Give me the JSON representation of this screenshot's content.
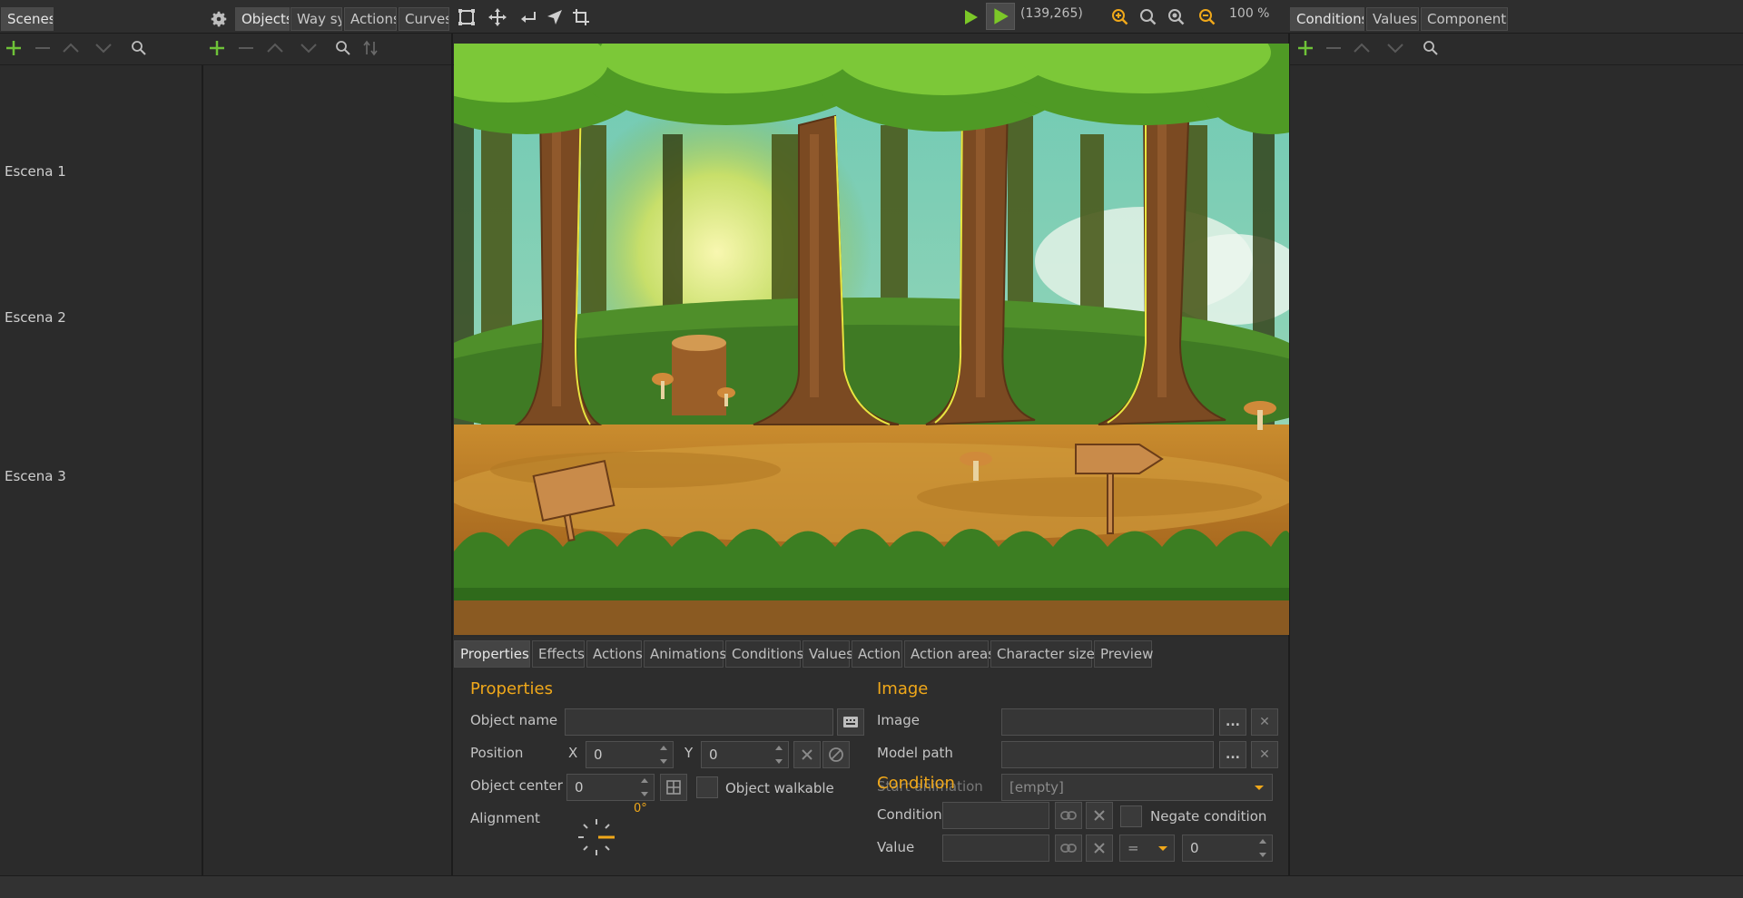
{
  "top_tabs": {
    "scenes": "Scenes",
    "objects": "Objects",
    "way_sys": "Way sys",
    "actions": "Actions",
    "curves": "Curves",
    "conditions": "Conditions",
    "values": "Values",
    "components": "Components"
  },
  "toolbar": {
    "coords": "(139,265)",
    "zoom": "100 %"
  },
  "scenes": [
    "Escena 1",
    "Escena 2",
    "Escena 3"
  ],
  "bottom_tabs": [
    "Properties",
    "Effects",
    "Actions",
    "Animations",
    "Conditions",
    "Values",
    "Action",
    "Action areas",
    "Character size",
    "Preview"
  ],
  "properties": {
    "title": "Properties",
    "object_name_label": "Object name",
    "object_name_value": "",
    "position_label": "Position",
    "x_label": "X",
    "x_value": "0",
    "y_label": "Y",
    "y_value": "0",
    "object_center_label": "Object center",
    "object_center_value": "0",
    "object_walkable_label": "Object walkable",
    "alignment_label": "Alignment",
    "alignment_angle": "0°"
  },
  "image": {
    "title": "Image",
    "image_label": "Image",
    "image_value": "",
    "model_path_label": "Model path",
    "model_path_value": "",
    "animation_label": "Start animation",
    "animation_value": "[empty]",
    "browse_label": "...",
    "clear_label": "✕"
  },
  "condition": {
    "title": "Condition",
    "condition_label": "Condition",
    "condition_value": "",
    "negate_label": "Negate condition",
    "value_label": "Value",
    "value_value": "",
    "operator_value": "=",
    "number_value": "0"
  },
  "colors": {
    "accent": "#f0a81a",
    "add_green": "#6ec238",
    "play_green": "#7cc828",
    "panel_bg": "#2b2b2b"
  }
}
